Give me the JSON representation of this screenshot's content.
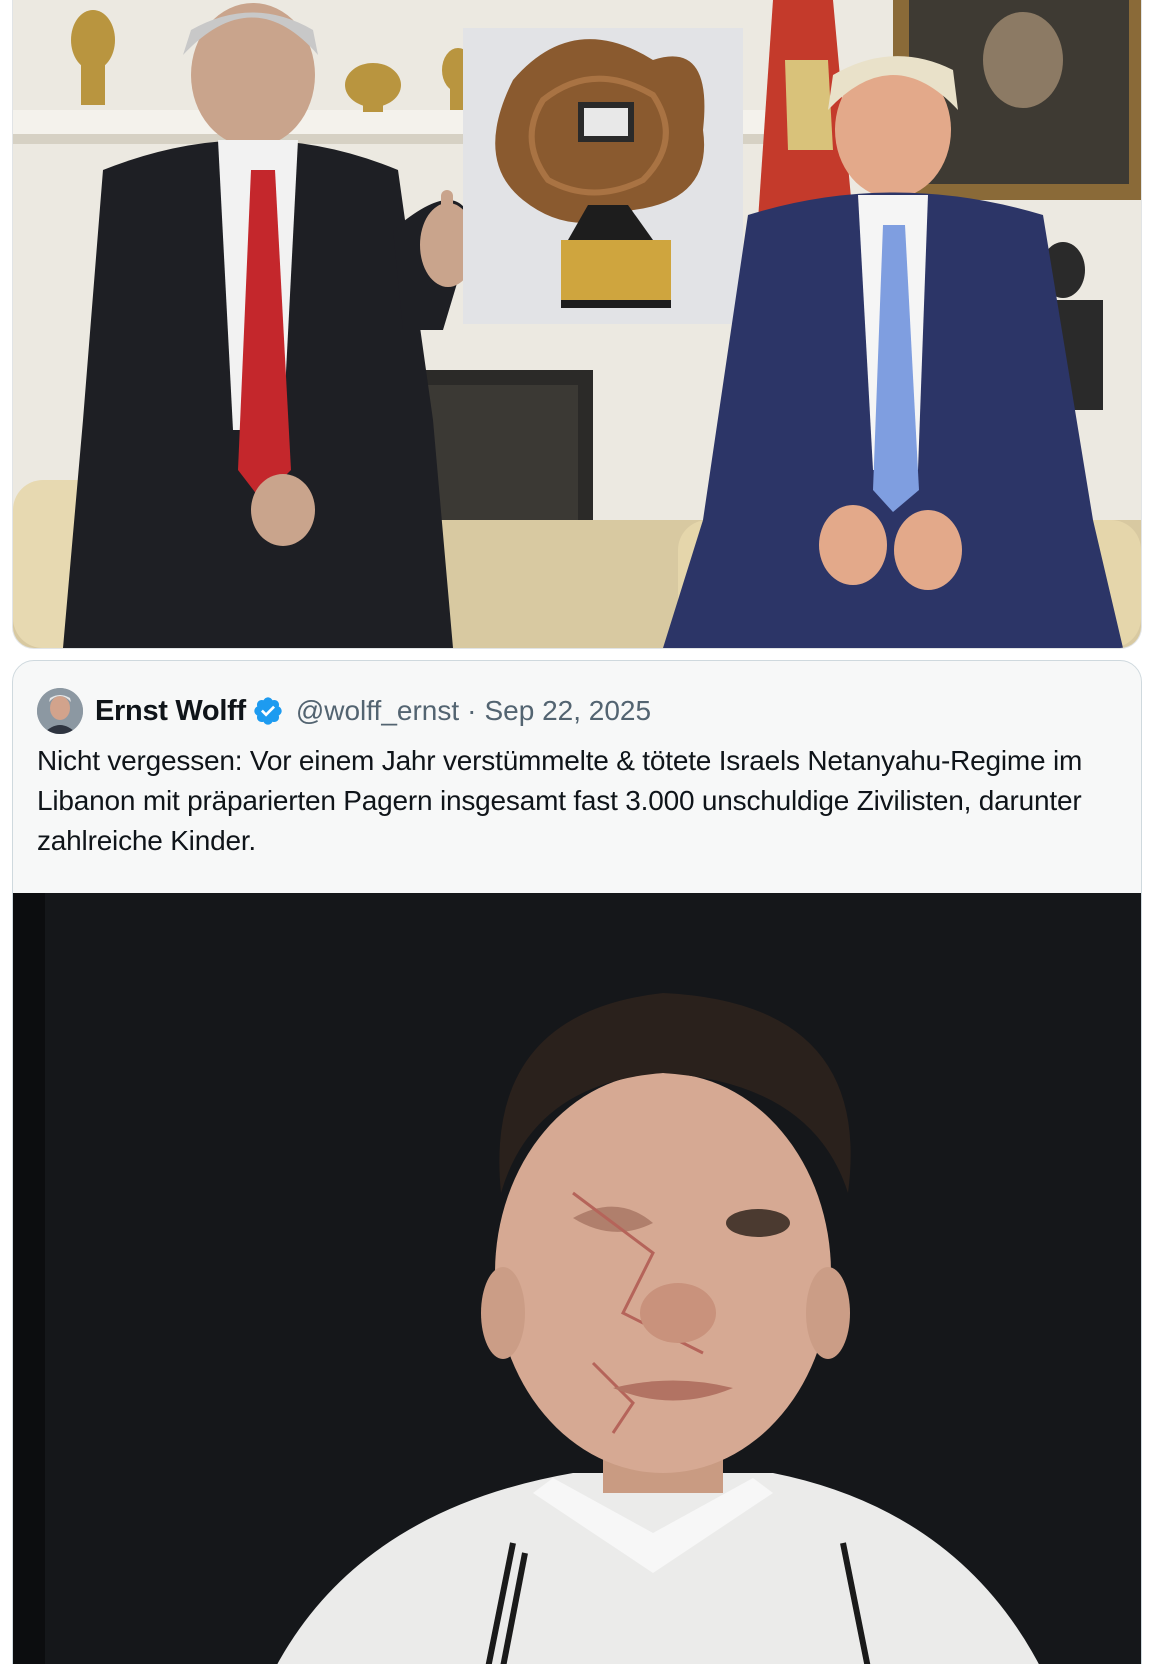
{
  "top_media": {
    "icon": "photo-leaders-meeting"
  },
  "quoted_post": {
    "author": {
      "name": "Ernst Wolff",
      "handle": "@wolff_ernst",
      "verified_icon": "verified-badge-icon",
      "verified_color": "#1d9bf0"
    },
    "separator": "·",
    "date": "Sep 22, 2025",
    "text": "Nicht vergessen: Vor einem Jahr verstümmelte & tötete Israels Netanyahu-Regime im Libanon mit präparierten Pagern insgesamt fast 3.000 unschuldige Zivilisten, darunter zahlreiche Kinder.",
    "media": {
      "icon": "photo-injured-boy"
    }
  },
  "colors": {
    "text_primary": "#0f1419",
    "text_secondary": "#536471",
    "card_border": "#cfd9de",
    "card_background": "#f7f8f8"
  }
}
